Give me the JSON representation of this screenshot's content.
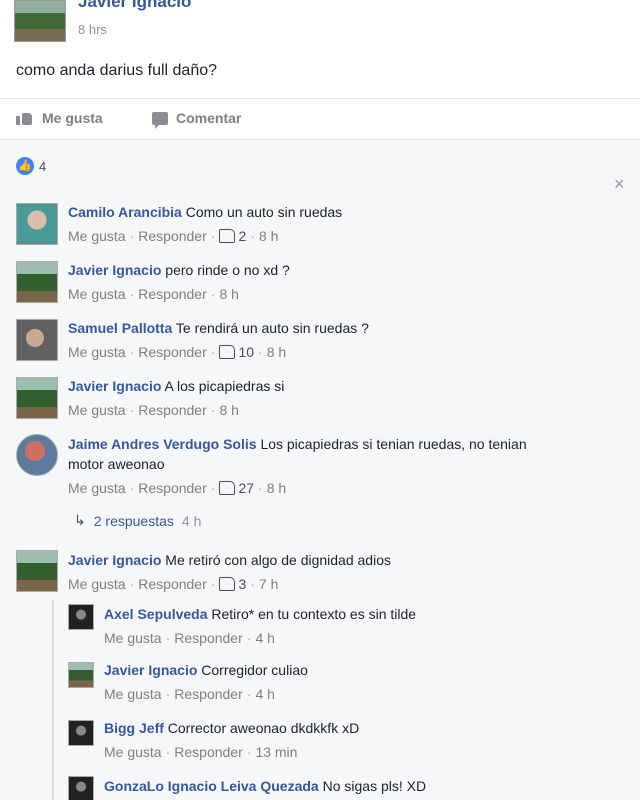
{
  "post": {
    "author": "Javier Ignacio",
    "time": "8 hrs",
    "text": "como anda darius full daño?"
  },
  "actions": {
    "like": "Me gusta",
    "comment": "Comentar"
  },
  "reactions": {
    "count": "4",
    "icon": "like-badge"
  },
  "labels": {
    "like": "Me gusta",
    "reply": "Responder",
    "dot": "·"
  },
  "comments": [
    {
      "name": "Camilo Arancibia",
      "text": "Como un auto sin ruedas",
      "likes": "2",
      "time": "8 h"
    },
    {
      "name": "Javier Ignacio",
      "text": "pero rinde o no xd ?",
      "likes": "",
      "time": "8 h"
    },
    {
      "name": "Samuel Pallotta",
      "text": "Te rendirá un auto sin ruedas ?",
      "likes": "10",
      "time": "8 h"
    },
    {
      "name": "Javier Ignacio",
      "text": "A los picapiedras si",
      "likes": "",
      "time": "8 h"
    },
    {
      "name": "Jaime Andres Verdugo Solis",
      "text": "Los picapiedras si tenian ruedas, no tenian",
      "text2": "motor aweonao",
      "likes": "27",
      "time": "8 h"
    },
    {
      "name": "Javier Ignacio",
      "text": "Me retiró con algo de dignidad adios",
      "likes": "3",
      "time": "7 h"
    }
  ],
  "replies_link": {
    "text": "2 respuestas",
    "time": "4 h"
  },
  "replies": [
    {
      "name": "Axel Sepulveda",
      "text": "Retiro* en tu contexto es sin tilde",
      "time": "4 h"
    },
    {
      "name": "Javier Ignacio",
      "text": "Corregidor culiao",
      "time": "4 h"
    },
    {
      "name": "Bigg Jeff",
      "text": "Corrector aweonao dkdkkfk xD",
      "time": "13 min"
    },
    {
      "name": "GonzaLo Ignacio Leiva Quezada",
      "text": "No sigas pls! XD",
      "time": ""
    }
  ],
  "close": "×"
}
